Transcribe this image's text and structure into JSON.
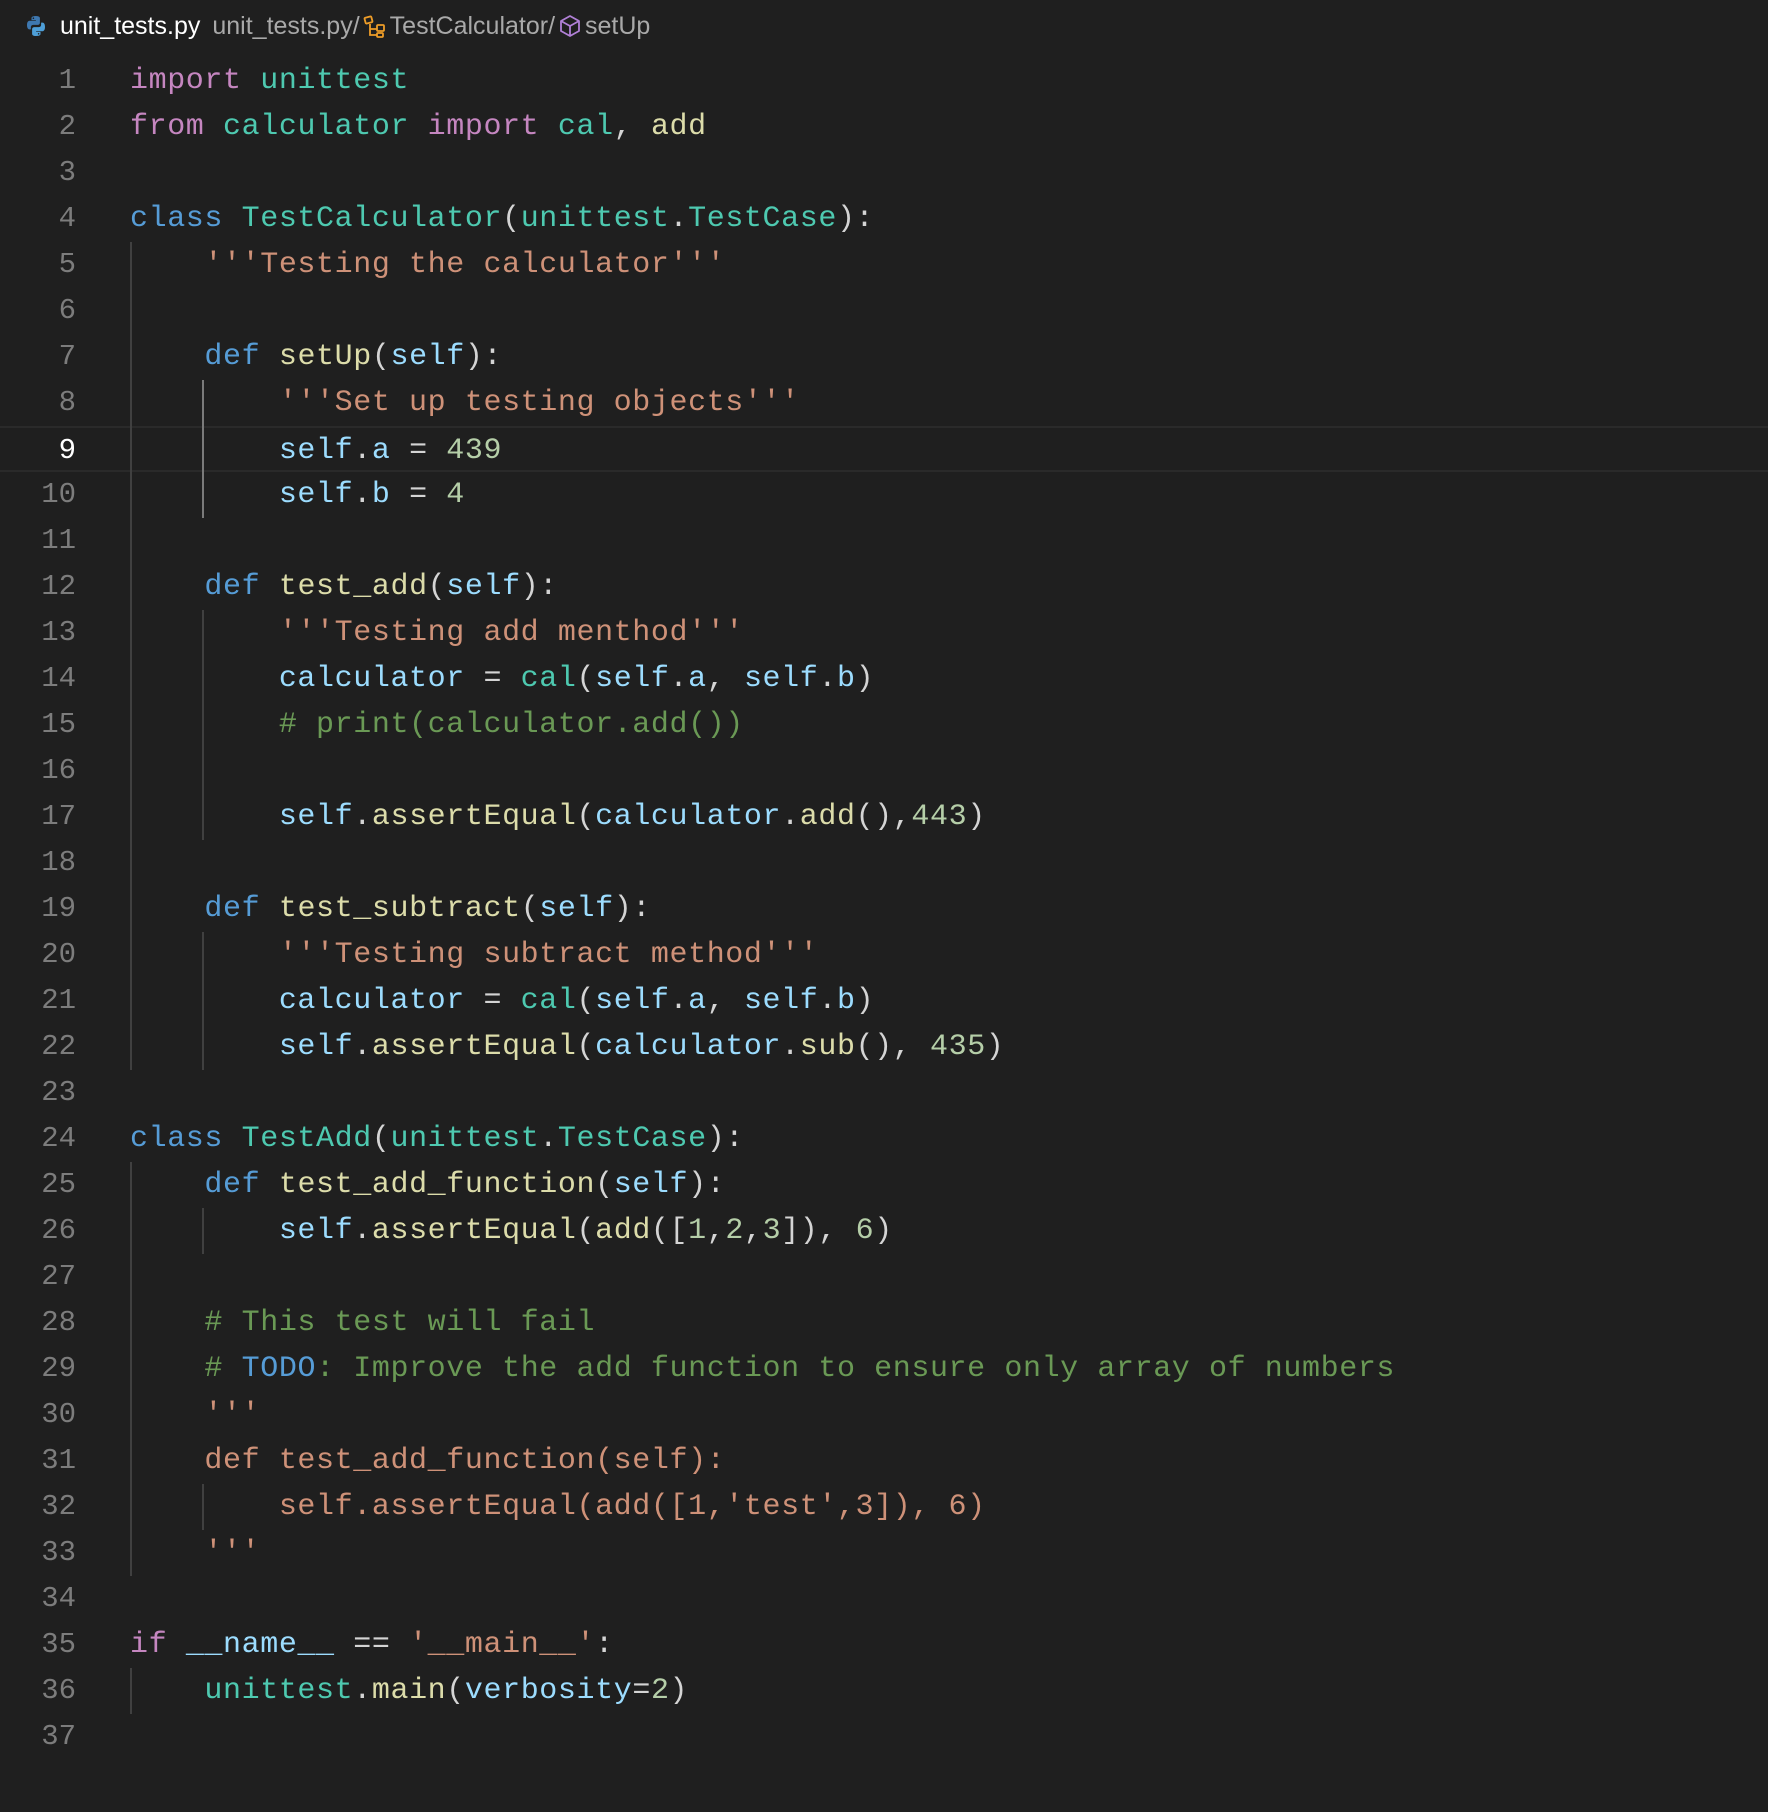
{
  "breadcrumbs": {
    "file_name": "unit_tests.py",
    "path": [
      {
        "label": "unit_tests.py/",
        "icon": "none"
      },
      {
        "label": "TestCalculator/",
        "icon": "class-icon"
      },
      {
        "label": "setUp",
        "icon": "method-icon"
      }
    ]
  },
  "editor": {
    "active_line": 9,
    "lines": [
      {
        "n": "1",
        "tokens": [
          [
            "import",
            "kw-import"
          ],
          [
            " ",
            "plain"
          ],
          [
            "unittest",
            "mod"
          ]
        ]
      },
      {
        "n": "2",
        "tokens": [
          [
            "from",
            "kw-import"
          ],
          [
            " ",
            "plain"
          ],
          [
            "calculator",
            "mod"
          ],
          [
            " ",
            "plain"
          ],
          [
            "import",
            "kw-import"
          ],
          [
            " ",
            "plain"
          ],
          [
            "cal",
            "mod"
          ],
          [
            ", ",
            "plain"
          ],
          [
            "add",
            "fn"
          ]
        ]
      },
      {
        "n": "3",
        "tokens": []
      },
      {
        "n": "4",
        "tokens": [
          [
            "class",
            "kw-blue"
          ],
          [
            " ",
            "plain"
          ],
          [
            "TestCalculator",
            "cls"
          ],
          [
            "(",
            "plain"
          ],
          [
            "unittest",
            "mod"
          ],
          [
            ".",
            "plain"
          ],
          [
            "TestCase",
            "cls"
          ],
          [
            "):",
            "plain"
          ]
        ]
      },
      {
        "n": "5",
        "tokens": [
          [
            "    ",
            "plain"
          ],
          [
            "'''Testing the calculator'''",
            "str"
          ]
        ]
      },
      {
        "n": "6",
        "tokens": []
      },
      {
        "n": "7",
        "tokens": [
          [
            "    ",
            "plain"
          ],
          [
            "def",
            "kw-blue"
          ],
          [
            " ",
            "plain"
          ],
          [
            "setUp",
            "fn"
          ],
          [
            "(",
            "plain"
          ],
          [
            "self",
            "var"
          ],
          [
            "):",
            "plain"
          ]
        ]
      },
      {
        "n": "8",
        "tokens": [
          [
            "        ",
            "plain"
          ],
          [
            "'''Set up testing objects'''",
            "str"
          ]
        ]
      },
      {
        "n": "9",
        "tokens": [
          [
            "        ",
            "plain"
          ],
          [
            "self",
            "var"
          ],
          [
            ".",
            "plain"
          ],
          [
            "a",
            "var"
          ],
          [
            " = ",
            "plain"
          ],
          [
            "439",
            "num"
          ]
        ]
      },
      {
        "n": "10",
        "tokens": [
          [
            "        ",
            "plain"
          ],
          [
            "self",
            "var"
          ],
          [
            ".",
            "plain"
          ],
          [
            "b",
            "var"
          ],
          [
            " = ",
            "plain"
          ],
          [
            "4",
            "num"
          ]
        ]
      },
      {
        "n": "11",
        "tokens": []
      },
      {
        "n": "12",
        "tokens": [
          [
            "    ",
            "plain"
          ],
          [
            "def",
            "kw-blue"
          ],
          [
            " ",
            "plain"
          ],
          [
            "test_add",
            "fn"
          ],
          [
            "(",
            "plain"
          ],
          [
            "self",
            "var"
          ],
          [
            "):",
            "plain"
          ]
        ]
      },
      {
        "n": "13",
        "tokens": [
          [
            "        ",
            "plain"
          ],
          [
            "'''Testing add menthod'''",
            "str"
          ]
        ]
      },
      {
        "n": "14",
        "tokens": [
          [
            "        ",
            "plain"
          ],
          [
            "calculator",
            "var"
          ],
          [
            " = ",
            "plain"
          ],
          [
            "cal",
            "mod"
          ],
          [
            "(",
            "plain"
          ],
          [
            "self",
            "var"
          ],
          [
            ".",
            "plain"
          ],
          [
            "a",
            "var"
          ],
          [
            ", ",
            "plain"
          ],
          [
            "self",
            "var"
          ],
          [
            ".",
            "plain"
          ],
          [
            "b",
            "var"
          ],
          [
            ")",
            "plain"
          ]
        ]
      },
      {
        "n": "15",
        "tokens": [
          [
            "        ",
            "plain"
          ],
          [
            "# print(calculator.add())",
            "cmt"
          ]
        ]
      },
      {
        "n": "16",
        "tokens": []
      },
      {
        "n": "17",
        "tokens": [
          [
            "        ",
            "plain"
          ],
          [
            "self",
            "var"
          ],
          [
            ".",
            "plain"
          ],
          [
            "assertEqual",
            "fn"
          ],
          [
            "(",
            "plain"
          ],
          [
            "calculator",
            "var"
          ],
          [
            ".",
            "plain"
          ],
          [
            "add",
            "fn"
          ],
          [
            "(),",
            "plain"
          ],
          [
            "443",
            "num"
          ],
          [
            ")",
            "plain"
          ]
        ]
      },
      {
        "n": "18",
        "tokens": []
      },
      {
        "n": "19",
        "tokens": [
          [
            "    ",
            "plain"
          ],
          [
            "def",
            "kw-blue"
          ],
          [
            " ",
            "plain"
          ],
          [
            "test_subtract",
            "fn"
          ],
          [
            "(",
            "plain"
          ],
          [
            "self",
            "var"
          ],
          [
            "):",
            "plain"
          ]
        ]
      },
      {
        "n": "20",
        "tokens": [
          [
            "        ",
            "plain"
          ],
          [
            "'''Testing subtract method'''",
            "str"
          ]
        ]
      },
      {
        "n": "21",
        "tokens": [
          [
            "        ",
            "plain"
          ],
          [
            "calculator",
            "var"
          ],
          [
            " = ",
            "plain"
          ],
          [
            "cal",
            "mod"
          ],
          [
            "(",
            "plain"
          ],
          [
            "self",
            "var"
          ],
          [
            ".",
            "plain"
          ],
          [
            "a",
            "var"
          ],
          [
            ", ",
            "plain"
          ],
          [
            "self",
            "var"
          ],
          [
            ".",
            "plain"
          ],
          [
            "b",
            "var"
          ],
          [
            ")",
            "plain"
          ]
        ]
      },
      {
        "n": "22",
        "tokens": [
          [
            "        ",
            "plain"
          ],
          [
            "self",
            "var"
          ],
          [
            ".",
            "plain"
          ],
          [
            "assertEqual",
            "fn"
          ],
          [
            "(",
            "plain"
          ],
          [
            "calculator",
            "var"
          ],
          [
            ".",
            "plain"
          ],
          [
            "sub",
            "fn"
          ],
          [
            "(), ",
            "plain"
          ],
          [
            "435",
            "num"
          ],
          [
            ")",
            "plain"
          ]
        ]
      },
      {
        "n": "23",
        "tokens": []
      },
      {
        "n": "24",
        "tokens": [
          [
            "class",
            "kw-blue"
          ],
          [
            " ",
            "plain"
          ],
          [
            "TestAdd",
            "cls"
          ],
          [
            "(",
            "plain"
          ],
          [
            "unittest",
            "mod"
          ],
          [
            ".",
            "plain"
          ],
          [
            "TestCase",
            "cls"
          ],
          [
            "):",
            "plain"
          ]
        ]
      },
      {
        "n": "25",
        "tokens": [
          [
            "    ",
            "plain"
          ],
          [
            "def",
            "kw-blue"
          ],
          [
            " ",
            "plain"
          ],
          [
            "test_add_function",
            "fn"
          ],
          [
            "(",
            "plain"
          ],
          [
            "self",
            "var"
          ],
          [
            "):",
            "plain"
          ]
        ]
      },
      {
        "n": "26",
        "tokens": [
          [
            "        ",
            "plain"
          ],
          [
            "self",
            "var"
          ],
          [
            ".",
            "plain"
          ],
          [
            "assertEqual",
            "fn"
          ],
          [
            "(",
            "plain"
          ],
          [
            "add",
            "fn"
          ],
          [
            "([",
            "plain"
          ],
          [
            "1",
            "num"
          ],
          [
            ",",
            "plain"
          ],
          [
            "2",
            "num"
          ],
          [
            ",",
            "plain"
          ],
          [
            "3",
            "num"
          ],
          [
            "]), ",
            "plain"
          ],
          [
            "6",
            "num"
          ],
          [
            ")",
            "plain"
          ]
        ]
      },
      {
        "n": "27",
        "tokens": []
      },
      {
        "n": "28",
        "tokens": [
          [
            "    ",
            "plain"
          ],
          [
            "# This test will fail",
            "cmt"
          ]
        ]
      },
      {
        "n": "29",
        "tokens": [
          [
            "    ",
            "plain"
          ],
          [
            "# ",
            "cmt"
          ],
          [
            "TODO",
            "todo"
          ],
          [
            ": Improve the add function to ensure only array of numbers",
            "cmt"
          ]
        ]
      },
      {
        "n": "30",
        "tokens": [
          [
            "    ",
            "plain"
          ],
          [
            "'''",
            "str"
          ]
        ]
      },
      {
        "n": "31",
        "tokens": [
          [
            "    ",
            "plain"
          ],
          [
            "def test_add_function(self):",
            "str"
          ]
        ]
      },
      {
        "n": "32",
        "tokens": [
          [
            "        ",
            "plain"
          ],
          [
            "self.assertEqual(add([1,'test',3]), 6)",
            "str"
          ]
        ]
      },
      {
        "n": "33",
        "tokens": [
          [
            "    ",
            "plain"
          ],
          [
            "'''",
            "str"
          ]
        ]
      },
      {
        "n": "34",
        "tokens": []
      },
      {
        "n": "35",
        "tokens": [
          [
            "if",
            "kw-import"
          ],
          [
            " ",
            "plain"
          ],
          [
            "__name__",
            "var"
          ],
          [
            " == ",
            "plain"
          ],
          [
            "'__main__'",
            "str"
          ],
          [
            ":",
            "plain"
          ]
        ]
      },
      {
        "n": "36",
        "tokens": [
          [
            "    ",
            "plain"
          ],
          [
            "unittest",
            "mod"
          ],
          [
            ".",
            "plain"
          ],
          [
            "main",
            "fn"
          ],
          [
            "(",
            "plain"
          ],
          [
            "verbosity",
            "var"
          ],
          [
            "=",
            "plain"
          ],
          [
            "2",
            "num"
          ],
          [
            ")",
            "plain"
          ]
        ]
      },
      {
        "n": "37",
        "tokens": []
      }
    ]
  },
  "colors": {
    "background": "#1f1f1f",
    "keyword_purple": "#c586c0",
    "keyword_blue": "#569cd6",
    "type_teal": "#4ec9b0",
    "function_yellow": "#dcdcaa",
    "variable_blue": "#9cdcfe",
    "string_orange": "#ce9178",
    "number_green": "#b5cea8",
    "comment_green": "#6a9955"
  }
}
